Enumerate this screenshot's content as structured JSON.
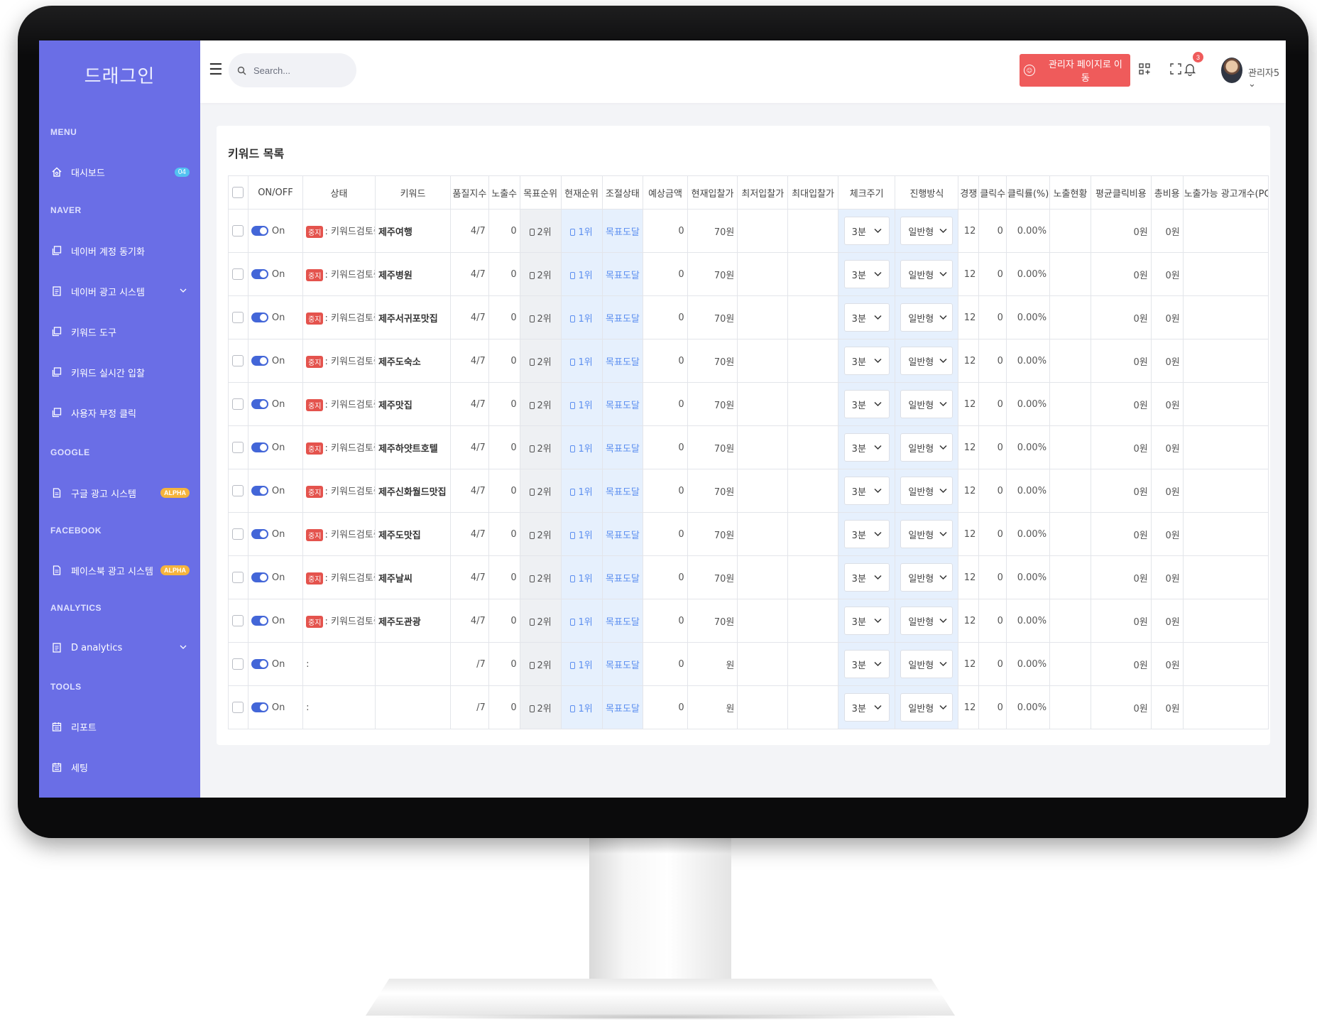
{
  "sidebar": {
    "brand": "드래그인",
    "sections": [
      {
        "label": "MENU",
        "items": [
          {
            "label": "대시보드",
            "icon": "home-icon",
            "badge": "04"
          }
        ]
      },
      {
        "label": "NAVER",
        "items": [
          {
            "label": "네이버 계정 동기화",
            "icon": "copy-icon"
          },
          {
            "label": "네이버 광고 시스템",
            "icon": "document-icon",
            "chevron": true
          },
          {
            "label": "키워드 도구",
            "icon": "copy-icon"
          },
          {
            "label": "키워드 실시간 입찰",
            "icon": "copy-icon"
          },
          {
            "label": "사용자 부정 클릭",
            "icon": "copy-icon"
          }
        ]
      },
      {
        "label": "GOOGLE",
        "items": [
          {
            "label": "구글 광고 시스템",
            "icon": "file-icon",
            "alpha": "ALPHA"
          }
        ]
      },
      {
        "label": "FACEBOOK",
        "items": [
          {
            "label": "페이스북 광고 시스템",
            "icon": "file-icon",
            "alpha": "ALPHA"
          }
        ]
      },
      {
        "label": "ANALYTICS",
        "items": [
          {
            "label": "D analytics",
            "icon": "document-icon",
            "chevron": true
          }
        ]
      },
      {
        "label": "TOOLS",
        "items": [
          {
            "label": "리포트",
            "icon": "calendar-icon"
          },
          {
            "label": "세팅",
            "icon": "calendar-icon"
          }
        ]
      }
    ]
  },
  "topbar": {
    "search_placeholder": "Search...",
    "admin_button": "관리자 페이지로 이동",
    "notification_count": "3",
    "user_name": "관리자5 ⌄"
  },
  "card": {
    "title": "키워드 목록",
    "columns": [
      "ON/OFF",
      "상태",
      "키워드",
      "품질지수",
      "노출수",
      "목표순위",
      "현재순위",
      "조절상태",
      "예상금액",
      "현재입찰가",
      "최저입찰가",
      "최대입찰가",
      "체크주기",
      "진행방식",
      "경쟁",
      "클릭수",
      "클릭률(%)",
      "노출현황",
      "평균클릭비용",
      "총비용",
      "노출가능 광고개수(PC)"
    ],
    "rows": [
      {
        "toggle": "On",
        "pill": "중지",
        "status": ": 키워드검토중",
        "keyword": "제주여행",
        "quality": "4/7",
        "impressions": "0",
        "target_rank": "2위",
        "current_rank": "1위",
        "adjust": "목표도달",
        "estimate": "0",
        "current_bid": "70원",
        "min_bid": "",
        "max_bid": "",
        "cycle": "3분",
        "mode": "일반형",
        "competition": "12",
        "clicks": "0",
        "ctr": "0.00%",
        "exposure": "",
        "avg_cpc": "0원",
        "total_cost": "0원",
        "ad_count": ""
      },
      {
        "toggle": "On",
        "pill": "중지",
        "status": ": 키워드검토중",
        "keyword": "제주병원",
        "quality": "4/7",
        "impressions": "0",
        "target_rank": "2위",
        "current_rank": "1위",
        "adjust": "목표도달",
        "estimate": "0",
        "current_bid": "70원",
        "min_bid": "",
        "max_bid": "",
        "cycle": "3분",
        "mode": "일반형",
        "competition": "12",
        "clicks": "0",
        "ctr": "0.00%",
        "exposure": "",
        "avg_cpc": "0원",
        "total_cost": "0원",
        "ad_count": ""
      },
      {
        "toggle": "On",
        "pill": "중지",
        "status": ": 키워드검토중",
        "keyword": "제주서귀포맛집",
        "quality": "4/7",
        "impressions": "0",
        "target_rank": "2위",
        "current_rank": "1위",
        "adjust": "목표도달",
        "estimate": "0",
        "current_bid": "70원",
        "min_bid": "",
        "max_bid": "",
        "cycle": "3분",
        "mode": "일반형",
        "competition": "12",
        "clicks": "0",
        "ctr": "0.00%",
        "exposure": "",
        "avg_cpc": "0원",
        "total_cost": "0원",
        "ad_count": ""
      },
      {
        "toggle": "On",
        "pill": "중지",
        "status": ": 키워드검토중",
        "keyword": "제주도숙소",
        "quality": "4/7",
        "impressions": "0",
        "target_rank": "2위",
        "current_rank": "1위",
        "adjust": "목표도달",
        "estimate": "0",
        "current_bid": "70원",
        "min_bid": "",
        "max_bid": "",
        "cycle": "3분",
        "mode": "일반형",
        "competition": "12",
        "clicks": "0",
        "ctr": "0.00%",
        "exposure": "",
        "avg_cpc": "0원",
        "total_cost": "0원",
        "ad_count": ""
      },
      {
        "toggle": "On",
        "pill": "중지",
        "status": ": 키워드검토중",
        "keyword": "제주맛집",
        "quality": "4/7",
        "impressions": "0",
        "target_rank": "2위",
        "current_rank": "1위",
        "adjust": "목표도달",
        "estimate": "0",
        "current_bid": "70원",
        "min_bid": "",
        "max_bid": "",
        "cycle": "3분",
        "mode": "일반형",
        "competition": "12",
        "clicks": "0",
        "ctr": "0.00%",
        "exposure": "",
        "avg_cpc": "0원",
        "total_cost": "0원",
        "ad_count": ""
      },
      {
        "toggle": "On",
        "pill": "중지",
        "status": ": 키워드검토중",
        "keyword": "제주하얏트호텔",
        "quality": "4/7",
        "impressions": "0",
        "target_rank": "2위",
        "current_rank": "1위",
        "adjust": "목표도달",
        "estimate": "0",
        "current_bid": "70원",
        "min_bid": "",
        "max_bid": "",
        "cycle": "3분",
        "mode": "일반형",
        "competition": "12",
        "clicks": "0",
        "ctr": "0.00%",
        "exposure": "",
        "avg_cpc": "0원",
        "total_cost": "0원",
        "ad_count": ""
      },
      {
        "toggle": "On",
        "pill": "중지",
        "status": ": 키워드검토중",
        "keyword": "제주신화월드맛집",
        "quality": "4/7",
        "impressions": "0",
        "target_rank": "2위",
        "current_rank": "1위",
        "adjust": "목표도달",
        "estimate": "0",
        "current_bid": "70원",
        "min_bid": "",
        "max_bid": "",
        "cycle": "3분",
        "mode": "일반형",
        "competition": "12",
        "clicks": "0",
        "ctr": "0.00%",
        "exposure": "",
        "avg_cpc": "0원",
        "total_cost": "0원",
        "ad_count": ""
      },
      {
        "toggle": "On",
        "pill": "중지",
        "status": ": 키워드검토중",
        "keyword": "제주도맛집",
        "quality": "4/7",
        "impressions": "0",
        "target_rank": "2위",
        "current_rank": "1위",
        "adjust": "목표도달",
        "estimate": "0",
        "current_bid": "70원",
        "min_bid": "",
        "max_bid": "",
        "cycle": "3분",
        "mode": "일반형",
        "competition": "12",
        "clicks": "0",
        "ctr": "0.00%",
        "exposure": "",
        "avg_cpc": "0원",
        "total_cost": "0원",
        "ad_count": ""
      },
      {
        "toggle": "On",
        "pill": "중지",
        "status": ": 키워드검토중",
        "keyword": "제주날씨",
        "quality": "4/7",
        "impressions": "0",
        "target_rank": "2위",
        "current_rank": "1위",
        "adjust": "목표도달",
        "estimate": "0",
        "current_bid": "70원",
        "min_bid": "",
        "max_bid": "",
        "cycle": "3분",
        "mode": "일반형",
        "competition": "12",
        "clicks": "0",
        "ctr": "0.00%",
        "exposure": "",
        "avg_cpc": "0원",
        "total_cost": "0원",
        "ad_count": ""
      },
      {
        "toggle": "On",
        "pill": "중지",
        "status": ": 키워드검토중",
        "keyword": "제주도관광",
        "quality": "4/7",
        "impressions": "0",
        "target_rank": "2위",
        "current_rank": "1위",
        "adjust": "목표도달",
        "estimate": "0",
        "current_bid": "70원",
        "min_bid": "",
        "max_bid": "",
        "cycle": "3분",
        "mode": "일반형",
        "competition": "12",
        "clicks": "0",
        "ctr": "0.00%",
        "exposure": "",
        "avg_cpc": "0원",
        "total_cost": "0원",
        "ad_count": ""
      },
      {
        "toggle": "On",
        "pill": "",
        "status": ":",
        "keyword": "",
        "quality": "/7",
        "impressions": "0",
        "target_rank": "2위",
        "current_rank": "1위",
        "adjust": "목표도달",
        "estimate": "0",
        "current_bid": "원",
        "min_bid": "",
        "max_bid": "",
        "cycle": "3분",
        "mode": "일반형",
        "competition": "12",
        "clicks": "0",
        "ctr": "0.00%",
        "exposure": "",
        "avg_cpc": "0원",
        "total_cost": "0원",
        "ad_count": ""
      },
      {
        "toggle": "On",
        "pill": "",
        "status": ":",
        "keyword": "",
        "quality": "/7",
        "impressions": "0",
        "target_rank": "2위",
        "current_rank": "1위",
        "adjust": "목표도달",
        "estimate": "0",
        "current_bid": "원",
        "min_bid": "",
        "max_bid": "",
        "cycle": "3분",
        "mode": "일반형",
        "competition": "12",
        "clicks": "0",
        "ctr": "0.00%",
        "exposure": "",
        "avg_cpc": "0원",
        "total_cost": "0원",
        "ad_count": ""
      }
    ]
  }
}
